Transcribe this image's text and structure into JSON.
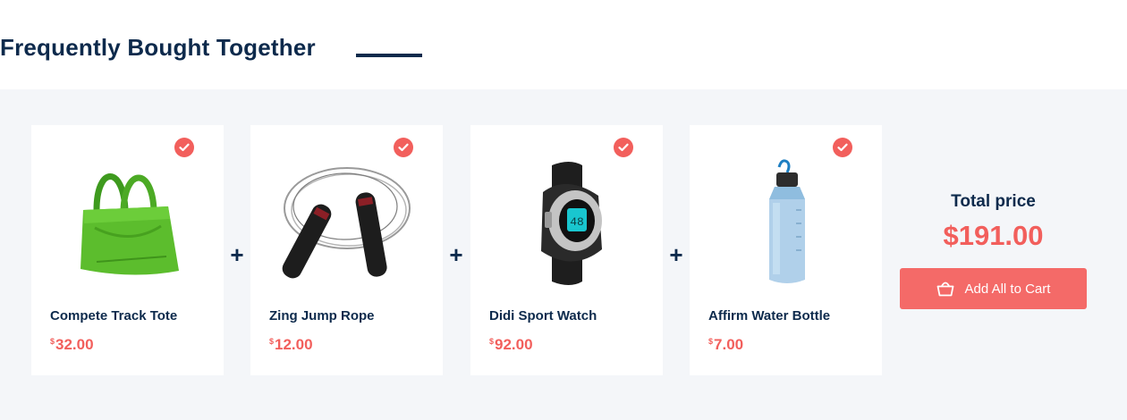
{
  "section": {
    "title": "Frequently Bought Together"
  },
  "products": [
    {
      "name": "Compete Track Tote",
      "currency": "$",
      "price": "32.00",
      "selected": true,
      "image_icon": "green-tote-bag-icon"
    },
    {
      "name": "Zing Jump Rope",
      "currency": "$",
      "price": "12.00",
      "selected": true,
      "image_icon": "jump-rope-icon"
    },
    {
      "name": "Didi Sport Watch",
      "currency": "$",
      "price": "92.00",
      "selected": true,
      "image_icon": "sport-watch-icon"
    },
    {
      "name": "Affirm Water Bottle",
      "currency": "$",
      "price": "7.00",
      "selected": true,
      "image_icon": "water-bottle-icon"
    }
  ],
  "separator": "+",
  "summary": {
    "total_label": "Total price",
    "total_value": "$191.00",
    "add_all_label": "Add All to Cart",
    "button_icon": "shopping-bag-icon"
  },
  "colors": {
    "accent": "#f25f5c",
    "button": "#f46a68",
    "heading": "#0d2a4c",
    "panel_bg": "#f4f6f9"
  }
}
